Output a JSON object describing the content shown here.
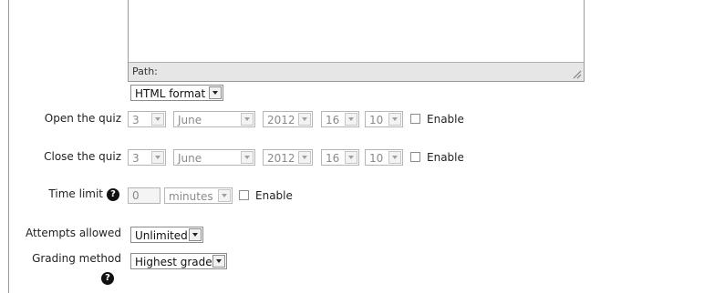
{
  "editor": {
    "path_label": "Path:",
    "format": "HTML format"
  },
  "open_quiz": {
    "label": "Open the quiz",
    "day": "3",
    "month": "June",
    "year": "2012",
    "hour": "16",
    "minute": "10",
    "enable": "Enable"
  },
  "close_quiz": {
    "label": "Close the quiz",
    "day": "3",
    "month": "June",
    "year": "2012",
    "hour": "16",
    "minute": "10",
    "enable": "Enable"
  },
  "time_limit": {
    "label": "Time limit",
    "value": "0",
    "unit": "minutes",
    "enable": "Enable"
  },
  "attempts": {
    "label": "Attempts allowed",
    "value": "Unlimited"
  },
  "grading": {
    "label": "Grading method",
    "value": "Highest grade"
  },
  "icons": {
    "help": "help-icon"
  }
}
